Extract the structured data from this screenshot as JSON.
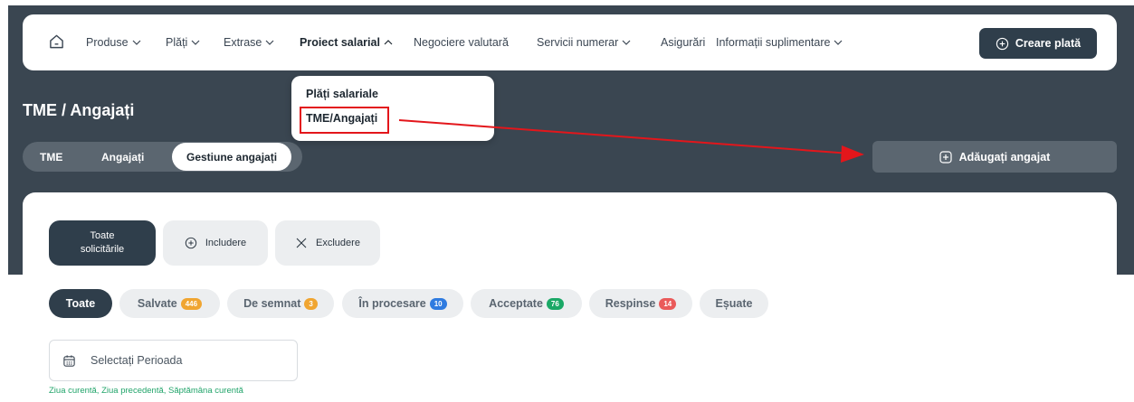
{
  "nav": {
    "items": [
      {
        "label": "Produse",
        "chevron": true
      },
      {
        "label": "Plăți",
        "chevron": true
      },
      {
        "label": "Extrase",
        "chevron": true
      },
      {
        "label": "Proiect salarial",
        "chevron": true,
        "expanded": true
      },
      {
        "label": "Negociere valutară",
        "chevron": false
      },
      {
        "label": "Servicii numerar",
        "chevron": true
      },
      {
        "label": "Asigurări",
        "chevron": false
      },
      {
        "label": "Informații suplimentare",
        "chevron": true
      }
    ],
    "create_label": "Creare plată"
  },
  "dropdown": {
    "items": [
      "Plăți salariale",
      "TME/Angajați"
    ]
  },
  "page": {
    "title": "TME / Angajați"
  },
  "tabs": {
    "items": [
      "TME",
      "Angajați",
      "Gestiune angajați"
    ],
    "selected": "Gestiune angajați"
  },
  "add_employee_label": "Adăugați angajat",
  "filters": {
    "all_requests_line1": "Toate",
    "all_requests_line2": "solicitările",
    "include_label": "Includere",
    "exclude_label": "Excludere"
  },
  "statuses": [
    {
      "label": "Toate",
      "count": null,
      "color": null
    },
    {
      "label": "Salvate",
      "count": "446",
      "color": "#f0a531"
    },
    {
      "label": "De semnat",
      "count": "3",
      "color": "#f0a531"
    },
    {
      "label": "În procesare",
      "count": "10",
      "color": "#2f7be0"
    },
    {
      "label": "Acceptate",
      "count": "76",
      "color": "#1aa866"
    },
    {
      "label": "Respinse",
      "count": "14",
      "color": "#ea5a5a"
    },
    {
      "label": "Eșuate",
      "count": null,
      "color": null
    }
  ],
  "date_filter": {
    "placeholder": "Selectați Perioada",
    "quick_links": [
      "Ziua curentă,",
      "Ziua precedentă,",
      "Săptămâna curentă"
    ]
  },
  "colors": {
    "header_bg": "#3a4651",
    "primary_dark": "#2f3e4b",
    "annotation_red": "#e3161b",
    "link_green": "#21a46a"
  }
}
